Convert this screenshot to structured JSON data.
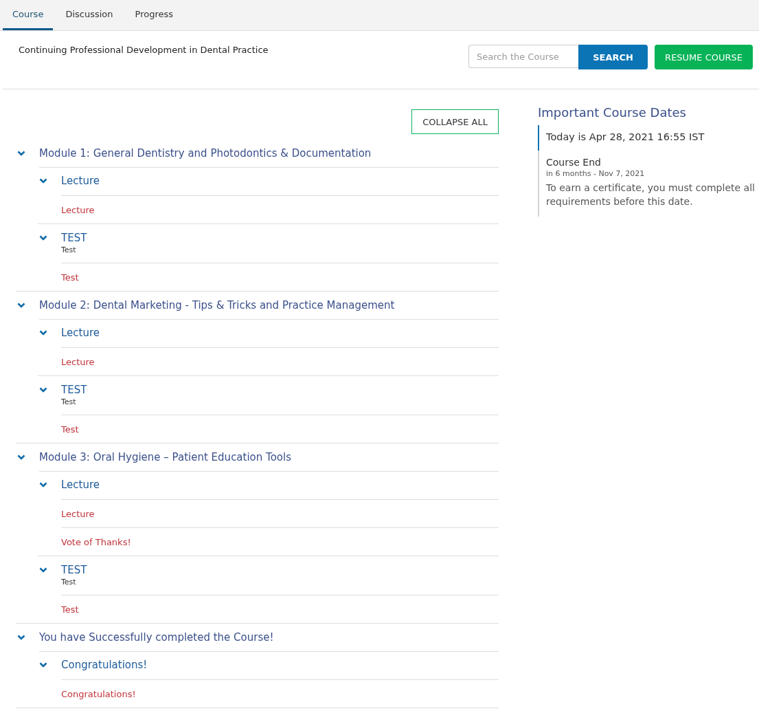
{
  "tabs": [
    {
      "label": "Course",
      "selected": true
    },
    {
      "label": "Discussion",
      "selected": false
    },
    {
      "label": "Progress",
      "selected": false
    }
  ],
  "course_title": "Continuing Professional Development in Dental Practice",
  "search": {
    "placeholder": "Search the Course",
    "button": "SEARCH"
  },
  "resume_button": "RESUME COURSE",
  "collapse_button": "COLLAPSE ALL",
  "outline": [
    {
      "title": "Module 1: General Dentistry and Photodontics & Documentation",
      "expanded": true,
      "children": [
        {
          "title": "Lecture",
          "expanded": true,
          "children": [
            {
              "title": "Lecture"
            }
          ]
        },
        {
          "title": "TEST",
          "subtitle": "Test",
          "expanded": true,
          "children": [
            {
              "title": "Test"
            }
          ]
        }
      ]
    },
    {
      "title": "Module 2: Dental Marketing - Tips & Tricks and Practice Management",
      "expanded": true,
      "children": [
        {
          "title": "Lecture",
          "expanded": true,
          "children": [
            {
              "title": "Lecture"
            }
          ]
        },
        {
          "title": "TEST",
          "subtitle": "Test",
          "expanded": true,
          "children": [
            {
              "title": "Test"
            }
          ]
        }
      ]
    },
    {
      "title": "Module 3: Oral Hygiene – Patient Education Tools",
      "expanded": true,
      "children": [
        {
          "title": "Lecture",
          "expanded": true,
          "children": [
            {
              "title": "Lecture"
            },
            {
              "title": "Vote of Thanks!"
            }
          ]
        },
        {
          "title": "TEST",
          "subtitle": "Test",
          "expanded": true,
          "children": [
            {
              "title": "Test"
            }
          ]
        }
      ]
    },
    {
      "title": "You have Successfully completed the Course!",
      "expanded": true,
      "children": [
        {
          "title": "Congratulations!",
          "expanded": true,
          "children": [
            {
              "title": "Congratulations!"
            }
          ]
        }
      ]
    }
  ],
  "dates": {
    "heading": "Important Course Dates",
    "items": [
      {
        "title": "Today is Apr 28, 2021 16:55 IST",
        "current": true
      },
      {
        "title": "Course End",
        "date": "in 6 months - Nov 7, 2021",
        "description": "To earn a certificate, you must complete all requirements before this date.",
        "current": false
      }
    ]
  }
}
